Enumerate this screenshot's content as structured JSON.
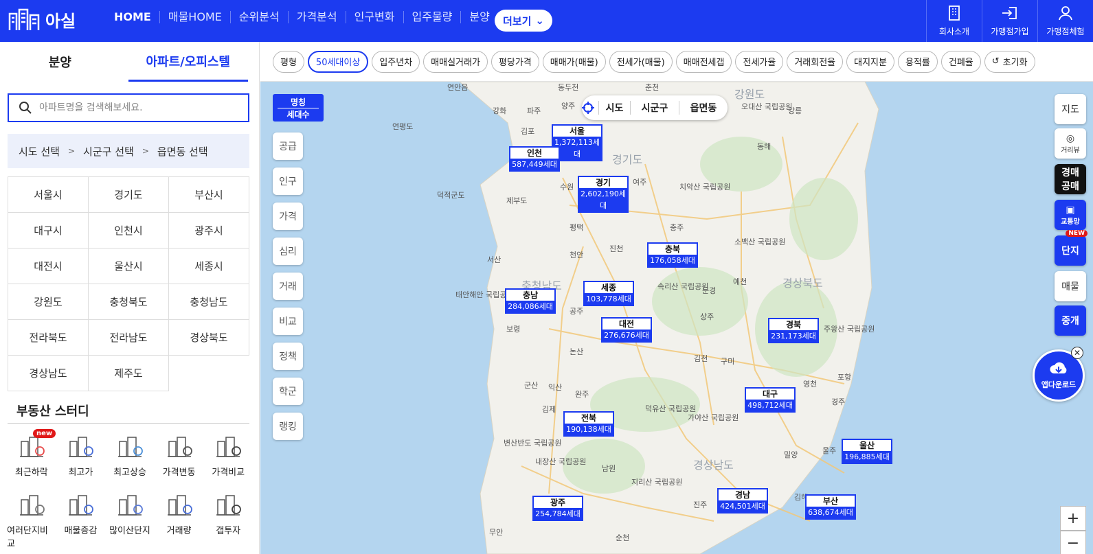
{
  "app": {
    "logo_text": "아실",
    "nav": [
      "HOME",
      "매물HOME",
      "순위분석",
      "가격분석",
      "인구변화",
      "입주물량",
      "분양"
    ],
    "more_label": "더보기",
    "top_right": [
      {
        "label": "회사소개",
        "icon": "building-icon"
      },
      {
        "label": "가맹점가입",
        "icon": "signin-icon"
      },
      {
        "label": "가맹점체험",
        "icon": "user-icon"
      }
    ]
  },
  "left": {
    "tabs": [
      "분양",
      "아파트/오피스텔"
    ],
    "active_tab": "아파트/오피스텔",
    "search_placeholder": "아파트명을 검색해보세요.",
    "breadcrumb": [
      "시도 선택",
      ">",
      "시군구 선택",
      ">",
      "읍면동 선택"
    ],
    "regions": [
      "서울시",
      "경기도",
      "부산시",
      "대구시",
      "인천시",
      "광주시",
      "대전시",
      "울산시",
      "세종시",
      "강원도",
      "충청북도",
      "충청남도",
      "전라북도",
      "전라남도",
      "경상북도",
      "경상남도",
      "제주도"
    ],
    "study_title": "부동산 스터디",
    "study_items": [
      {
        "label": "최근하락",
        "badge": "new"
      },
      {
        "label": "최고가"
      },
      {
        "label": "최고상승"
      },
      {
        "label": "가격변동"
      },
      {
        "label": "가격비교"
      },
      {
        "label": "여러단지비교"
      },
      {
        "label": "매물증감"
      },
      {
        "label": "많이산단지"
      },
      {
        "label": "거래량"
      },
      {
        "label": "갭투자"
      }
    ]
  },
  "filters": [
    "평형",
    "50세대이상",
    "입주년차",
    "매매실거래가",
    "평당가격",
    "매매가(매물)",
    "전세가(매물)",
    "매매전세갭",
    "전세가율",
    "거래회전율",
    "대지지분",
    "용적률",
    "건폐율"
  ],
  "active_filter": "50세대이상",
  "reset_label": "초기화",
  "map": {
    "name_toggle": [
      "명칭",
      "세대수"
    ],
    "side_buttons": [
      "공급",
      "인구",
      "가격",
      "심리",
      "거래",
      "비교",
      "정책",
      "학군",
      "랭킹"
    ],
    "level_selector": [
      "시도",
      "시군구",
      "읍면동"
    ],
    "right_buttons": [
      "지도",
      "거리뷰",
      "경매\n공매",
      "교통망",
      "단지",
      "매물",
      "중개"
    ],
    "right_new_badge": "NEW",
    "app_download": "앱다운로드",
    "markers": [
      {
        "name": "서울",
        "count": "1,372,113세대"
      },
      {
        "name": "인천",
        "count": "587,449세대"
      },
      {
        "name": "경기",
        "count": "2,602,190세대"
      },
      {
        "name": "충북",
        "count": "176,058세대"
      },
      {
        "name": "세종",
        "count": "103,778세대"
      },
      {
        "name": "충남",
        "count": "284,086세대"
      },
      {
        "name": "대전",
        "count": "276,676세대"
      },
      {
        "name": "경북",
        "count": "231,173세대"
      },
      {
        "name": "대구",
        "count": "498,712세대"
      },
      {
        "name": "전북",
        "count": "190,138세대"
      },
      {
        "name": "울산",
        "count": "196,885세대"
      },
      {
        "name": "경남",
        "count": "424,501세대"
      },
      {
        "name": "부산",
        "count": "638,674세대"
      },
      {
        "name": "광주",
        "count": "254,784세대"
      }
    ],
    "places": [
      "연안읍",
      "동두천",
      "춘천",
      "강화",
      "파주",
      "양주",
      "강릉",
      "연평도",
      "김포",
      "동해",
      "덕적군도",
      "제부도",
      "수원",
      "여주",
      "치악산 국립공원",
      "평택",
      "충주",
      "서산",
      "천안",
      "진천",
      "소백산 국립공원",
      "예천",
      "태안해안 국립공원",
      "속리산 국립공원",
      "문경",
      "보령",
      "공주",
      "상주",
      "논산",
      "김천",
      "구미",
      "영천",
      "포항",
      "군산",
      "익산",
      "완주",
      "김제",
      "덕유산 국립공원",
      "가야산 국립공원",
      "경주",
      "변산반도 국립공원",
      "밀양",
      "울주",
      "내장산 국립공원",
      "남원",
      "지리산 국립공원",
      "진주",
      "김해",
      "무안",
      "순천",
      "오대산 국립공원",
      "주왕산 국립공원"
    ],
    "region_labels": [
      "경기도",
      "충청남도",
      "경상북도",
      "경상남도",
      "강원도"
    ]
  }
}
